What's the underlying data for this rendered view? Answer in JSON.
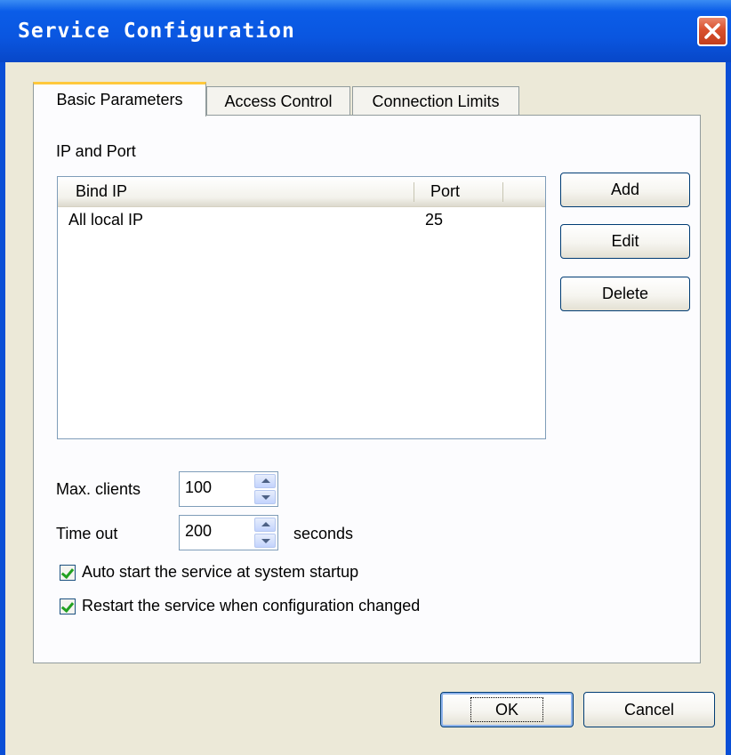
{
  "window": {
    "title": "Service Configuration"
  },
  "tabs": [
    {
      "label": "Basic Parameters",
      "active": true
    },
    {
      "label": "Access Control",
      "active": false
    },
    {
      "label": "Connection Limits",
      "active": false
    }
  ],
  "ip_port": {
    "section_label": "IP and Port",
    "columns": [
      "Bind IP",
      "Port"
    ],
    "rows": [
      {
        "bind_ip": "All local IP",
        "port": "25"
      }
    ],
    "buttons": {
      "add": "Add",
      "edit": "Edit",
      "delete": "Delete"
    }
  },
  "max_clients": {
    "label": "Max. clients",
    "value": "100"
  },
  "time_out": {
    "label": "Time out",
    "value": "200",
    "unit": "seconds"
  },
  "options": [
    {
      "label": "Auto start the service at system startup",
      "checked": true
    },
    {
      "label": "Restart the service when configuration changed",
      "checked": true
    }
  ],
  "footer": {
    "ok": "OK",
    "cancel": "Cancel"
  },
  "colors": {
    "titlebar": "#0a56e0",
    "dialog_bg": "#ece9d8",
    "tab_accent": "#ffc83c",
    "check": "#21a121"
  },
  "icons": {
    "close": "close-icon",
    "spin_up": "arrow-up-icon",
    "spin_down": "arrow-down-icon",
    "check": "checkmark-icon"
  }
}
